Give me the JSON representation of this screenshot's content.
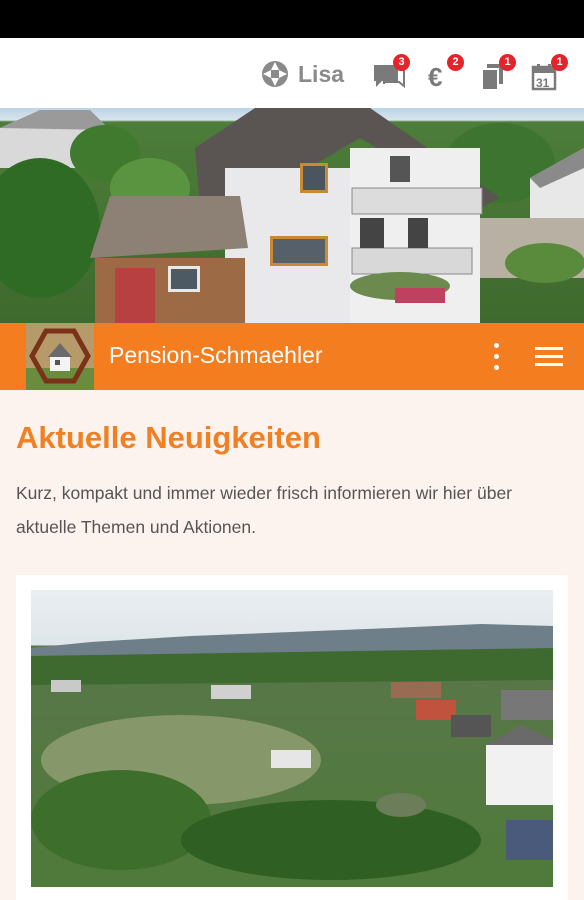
{
  "header": {
    "user_name": "Lisa",
    "icons": [
      {
        "name": "chat-icon",
        "badge": "3"
      },
      {
        "name": "euro-icon",
        "badge": "2"
      },
      {
        "name": "documents-icon",
        "badge": "1"
      },
      {
        "name": "calendar-icon",
        "badge": "1",
        "day": "31"
      }
    ]
  },
  "appbar": {
    "title": "Pension-Schmaehler",
    "accent": "#f47d20"
  },
  "main": {
    "heading": "Aktuelle Neuigkeiten",
    "intro": "Kurz, kompakt und immer wieder frisch informieren wir hier über aktuelle Themen und Aktionen."
  },
  "colors": {
    "accent": "#f47d20",
    "heading": "#f08024",
    "badge": "#e4242b",
    "background": "#fdf3ee"
  }
}
